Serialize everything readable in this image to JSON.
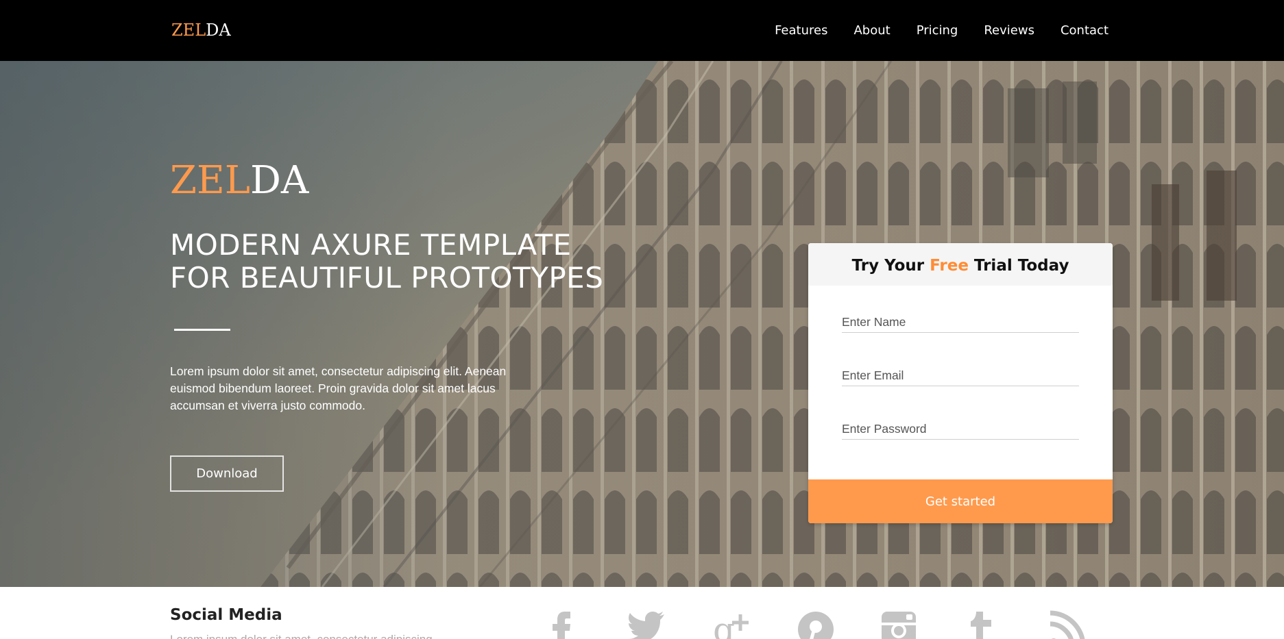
{
  "nav": {
    "logo": {
      "accent": "ZEL",
      "rest": "DA"
    },
    "items": [
      {
        "label": "Features"
      },
      {
        "label": "About"
      },
      {
        "label": "Pricing"
      },
      {
        "label": "Reviews"
      },
      {
        "label": "Contact"
      }
    ]
  },
  "hero": {
    "logo": {
      "accent": "ZEL",
      "rest": "DA"
    },
    "headline_line1": "MODERN AXURE TEMPLATE",
    "headline_line2": "FOR BEAUTIFUL PROTOTYPES",
    "lead": "Lorem ipsum dolor sit amet, consectetur adipiscing elit. Aenean euismod bibendum laoreet. Proin gravida dolor sit amet lacus accumsan et viverra justo commodo.",
    "download_label": "Download"
  },
  "trial_form": {
    "title_prefix": "Try Your ",
    "title_highlight": "Free",
    "title_suffix": " Trial Today",
    "name_placeholder": "Enter Name",
    "email_placeholder": "Enter Email",
    "password_placeholder": "Enter Password",
    "submit_label": "Get started"
  },
  "footer": {
    "title": "Social Media",
    "text": "Lorem ipsum dolor sit amet, consectetur adipiscing",
    "social_icons": [
      "facebook-icon",
      "twitter-icon",
      "google-plus-icon",
      "pinterest-icon",
      "instagram-icon",
      "tumblr-icon",
      "rss-icon"
    ]
  },
  "colors": {
    "accent": "#ff9a4d",
    "nav_background": "#000000",
    "icon_gray": "#c4c4c4"
  }
}
